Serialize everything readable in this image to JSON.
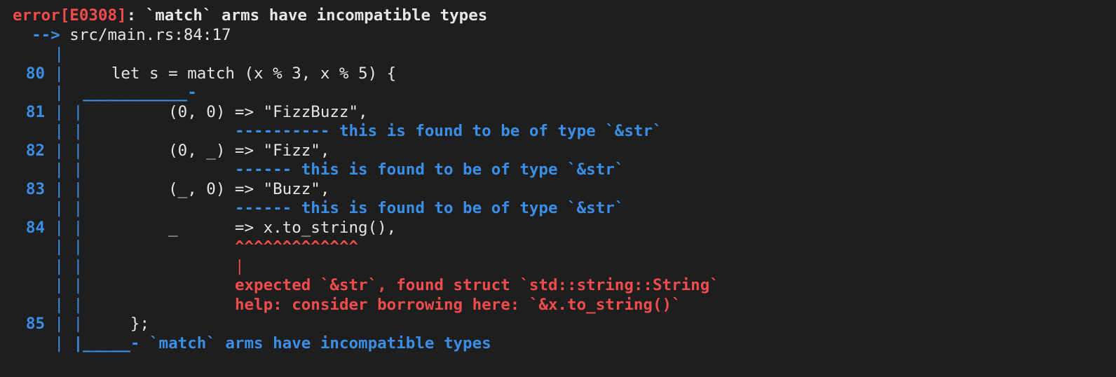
{
  "header": {
    "error_code": "error[E0308]",
    "message": ": `match` arms have incompatible types"
  },
  "location": {
    "arrow": "-->",
    "path": "src/main.rs:84:17"
  },
  "gutter_bar": "|",
  "code_lines": [
    {
      "num": "80",
      "text": "     let s = match (x % 3, x % 5) {"
    },
    {
      "num": "81",
      "text": "         (0, 0) => \"FizzBuzz\","
    },
    {
      "num": "82",
      "text": "         (0, _) => \"Fizz\","
    },
    {
      "num": "83",
      "text": "         (_, 0) => \"Buzz\","
    },
    {
      "num": "84",
      "text": "         _      => x.to_string(),"
    },
    {
      "num": "85",
      "text": "     };"
    }
  ],
  "annotations": {
    "match_start_underline": "___________-",
    "arm81_dashes": "----------",
    "arm81_label": "this is found to be of type `&str`",
    "arm82_dashes": "------",
    "arm82_label": "this is found to be of type `&str`",
    "arm83_dashes": "------",
    "arm83_label": "this is found to be of type `&str`",
    "carets": "^^^^^^^^^^^^^",
    "caret_pipe": "|",
    "expected_msg": "expected `&str`, found struct `std::string::String`",
    "help_msg": "help: consider borrowing here: `&x.to_string()`",
    "match_end_underline": "|_____-",
    "match_end_label": "`match` arms have incompatible types"
  },
  "colors": {
    "background": "#1e1e1e",
    "error_red": "#f14c4c",
    "info_blue": "#3a8ee6",
    "text": "#e6e6e6"
  }
}
